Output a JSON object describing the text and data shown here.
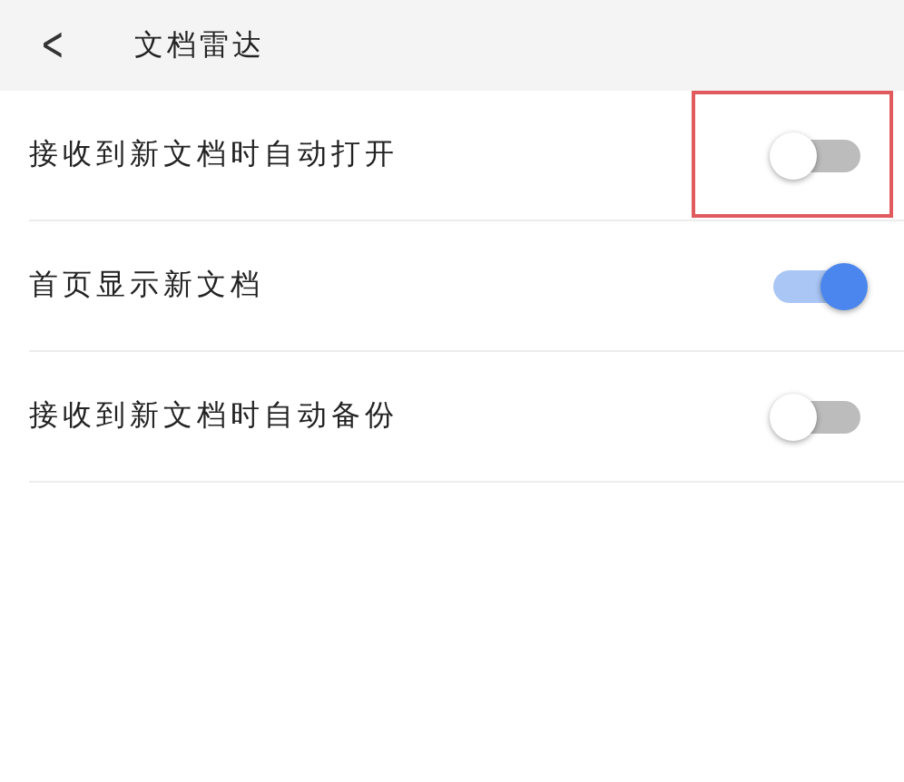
{
  "header": {
    "back": "<",
    "title": "文档雷达"
  },
  "settings": [
    {
      "label": "接收到新文档时自动打开",
      "on": false,
      "highlighted": true
    },
    {
      "label": "首页显示新文档",
      "on": true,
      "highlighted": false
    },
    {
      "label": "接收到新文档时自动备份",
      "on": false,
      "highlighted": false
    }
  ]
}
